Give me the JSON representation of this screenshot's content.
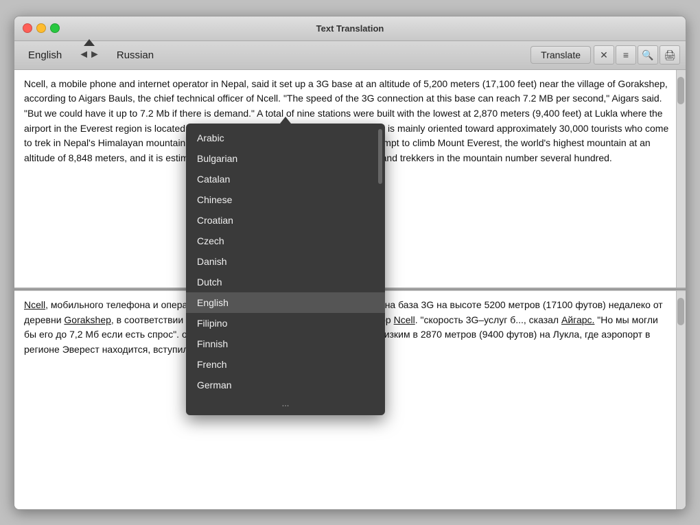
{
  "window": {
    "title": "Text Translation"
  },
  "toolbar": {
    "source_lang": "English",
    "swap_icon": "◄►",
    "target_lang": "Russian",
    "translate_label": "Translate",
    "icon_close": "✕",
    "icon_menu": "≡",
    "icon_search": "⌕",
    "icon_print": "⎙"
  },
  "english_text": "Ncell, a mobile phone and internet operator in Nepal, said it set up a 3G base at an altitude of 5,200 meters (17,100 feet) near the village of Gorakshep, according to Aigars Bauls, the chief technical officer of Ncell. \"The speed of the 3G connection at this base can reach 7.2 MB per second,\" Aigars said. \"But we could have it up to 7.2 Mb if there is demand.\" A total of nine stations were built with the lowest at 2,870 meters (9,400 feet) at Lukla where the airport in the Everest region is located, came into operation on Thursday. The service is mainly oriented toward approximately 30,000 tourists who come to trek in Nepal's Himalayan mountains every year. A few hundred mountaineers attempt to climb Mount Everest, the world's highest mountain at an altitude of 8,848 meters, and it is estimated that the annual total number of climbers and trekkers in the mountain number several hundred.",
  "russian_text": "Ncell, мобильного телефона и оператора Интернета в Непале, сказал, что создана база 3G на высоте 5200 метров (17100 футов) недалеко от деревни Gorakshep, в соответствии с Aigars Bauls, главный технический директор Ncell. \"скорость 3G–услуг б..., сказал Айгарс. \"Но мы могли бы его до 7,2 Мб если есть спрос\". общей сложности девять станций, с самым низким в 2870 метров (9400 футов) на Лукла, где аэропорт в регионе Эверест находится, вступил в силу в четверг.",
  "dropdown": {
    "items": [
      {
        "label": "Arabic",
        "selected": false
      },
      {
        "label": "Bulgarian",
        "selected": false
      },
      {
        "label": "Catalan",
        "selected": false
      },
      {
        "label": "Chinese",
        "selected": false
      },
      {
        "label": "Croatian",
        "selected": false
      },
      {
        "label": "Czech",
        "selected": false
      },
      {
        "label": "Danish",
        "selected": false
      },
      {
        "label": "Dutch",
        "selected": false
      },
      {
        "label": "English",
        "selected": true
      },
      {
        "label": "Filipino",
        "selected": false
      },
      {
        "label": "Finnish",
        "selected": false
      },
      {
        "label": "French",
        "selected": false
      },
      {
        "label": "German",
        "selected": false
      }
    ],
    "more": "..."
  }
}
